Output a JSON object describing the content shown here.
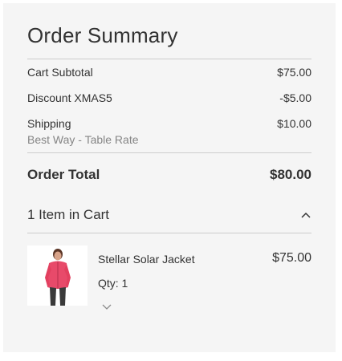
{
  "summary": {
    "title": "Order Summary",
    "rows": {
      "subtotal": {
        "label": "Cart Subtotal",
        "value": "$75.00"
      },
      "discount": {
        "label": "Discount XMAS5",
        "value": "-$5.00"
      },
      "shipping": {
        "label": "Shipping",
        "value": "$10.00",
        "method": "Best Way - Table Rate"
      }
    },
    "total": {
      "label": "Order Total",
      "value": "$80.00"
    }
  },
  "cart": {
    "items_label": "1 Item in Cart",
    "toggle_icon": "chevron-up-icon",
    "items": [
      {
        "name": "Stellar Solar Jacket",
        "price": "$75.00",
        "qty_label": "Qty: 1",
        "options_icon": "chevron-down-icon"
      }
    ]
  },
  "colors": {
    "panel_background": "#f5f5f5",
    "divider": "#cccccc",
    "muted_text": "#858585",
    "jacket": "#e84a6a"
  }
}
